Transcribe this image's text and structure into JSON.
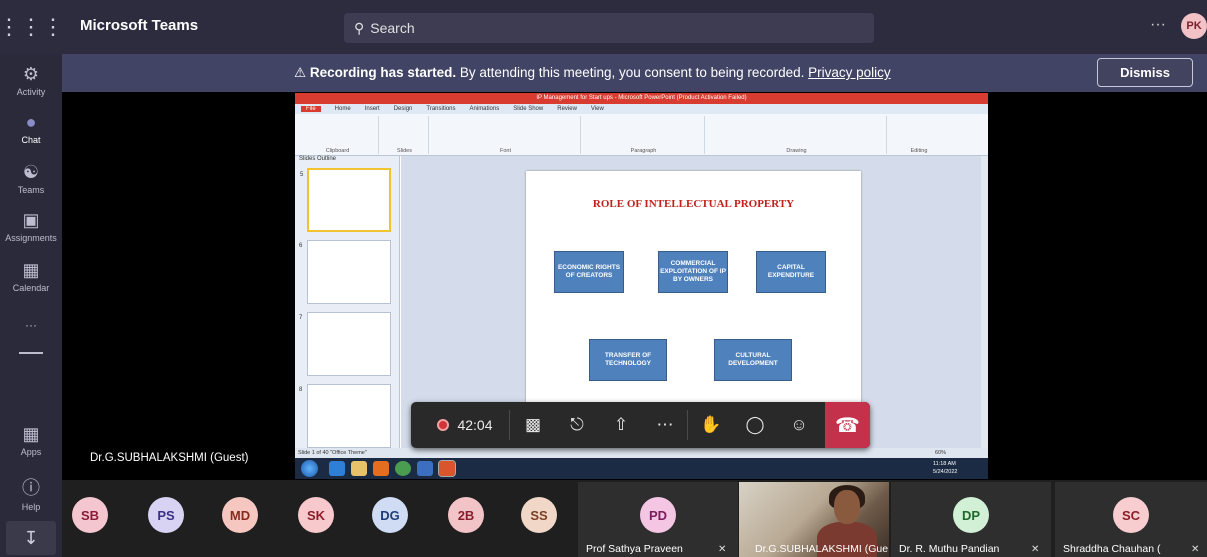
{
  "topbar": {
    "app_title": "Microsoft Teams",
    "search_placeholder": "Search",
    "more": "···",
    "user_initials": "PK"
  },
  "rail": {
    "items": [
      {
        "label": "Activity",
        "icon": "bell-icon"
      },
      {
        "label": "Chat",
        "icon": "chat-icon"
      },
      {
        "label": "Teams",
        "icon": "teams-icon"
      },
      {
        "label": "Assignments",
        "icon": "assignments-icon"
      },
      {
        "label": "Calendar",
        "icon": "calendar-icon"
      },
      {
        "label": "···",
        "icon": "more-icon"
      },
      {
        "label": "Apps",
        "icon": "apps-icon"
      },
      {
        "label": "Help",
        "icon": "help-icon"
      }
    ]
  },
  "banner": {
    "bold": "Recording has started.",
    "text": " By attending this meeting, you consent to being recorded. ",
    "link": "Privacy policy",
    "dismiss": "Dismiss"
  },
  "presentation": {
    "window_title": "IP Management for Start ups - Microsoft PowerPoint (Product Activation Failed)",
    "tabs": [
      "File",
      "Home",
      "Insert",
      "Design",
      "Transitions",
      "Animations",
      "Slide Show",
      "Review",
      "View"
    ],
    "ribbon_groups": [
      "Clipboard",
      "Slides",
      "Font",
      "Paragraph",
      "Drawing",
      "Editing"
    ],
    "panel_tabs": "Slides   Outline",
    "thumb_numbers": [
      "5",
      "6",
      "7",
      "8"
    ],
    "slide": {
      "title": "ROLE OF INTELLECTUAL PROPERTY",
      "boxes": [
        "ECONOMIC RIGHTS OF CREATORS",
        "COMMERCIAL EXPLOITATION OF IP BY OWNERS",
        "CAPITAL EXPENDITURE",
        "TRANSFER OF TECHNOLOGY",
        "CULTURAL DEVELOPMENT"
      ]
    },
    "status": "Slide 1 of 40   \"Office Theme\"",
    "zoom": "60%",
    "clock_time": "11:18 AM",
    "clock_date": "5/24/2022"
  },
  "presenter_label": "Dr.G.SUBHALAKSHMI (Guest)",
  "call_controls": {
    "timer": "42:04"
  },
  "participants": [
    {
      "initials": "SB",
      "color": "#f4c6cf",
      "text": "#8a1c38"
    },
    {
      "initials": "PS",
      "color": "#d8d3f2",
      "text": "#3b2f86"
    },
    {
      "initials": "MD",
      "color": "#f6c7c0",
      "text": "#8a2a1d"
    },
    {
      "initials": "SK",
      "color": "#f7c9cc",
      "text": "#8c1d2c"
    },
    {
      "initials": "DG",
      "color": "#cfdcf4",
      "text": "#1f3d7a"
    },
    {
      "initials": "2B",
      "color": "#f3c4c7",
      "text": "#8a1f2c"
    },
    {
      "initials": "SS",
      "color": "#f0d7c8",
      "text": "#7a3f22"
    }
  ],
  "named_tiles": [
    {
      "initials": "PD",
      "name": "Prof Sathya Praveen",
      "color": "#f4c6e4",
      "text": "#7a1d5b"
    },
    {
      "initials": "",
      "name": "Dr.G.SUBHALAKSHMI (Gue",
      "video": true
    },
    {
      "initials": "DP",
      "name": "Dr. R. Muthu Pandian",
      "color": "#d2f0d6",
      "text": "#1e6a2b"
    },
    {
      "initials": "SC",
      "name": "Shraddha Chauhan (",
      "color": "#f7cdd0",
      "text": "#8a1f2a"
    }
  ]
}
